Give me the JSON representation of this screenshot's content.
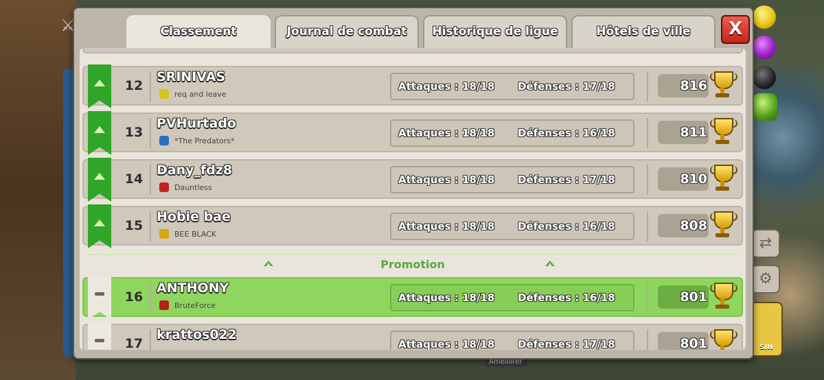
{
  "tabs": [
    {
      "label": "Classement",
      "active": true
    },
    {
      "label": "Journal de combat",
      "active": false
    },
    {
      "label": "Historique de ligue",
      "active": false
    },
    {
      "label": "Hôtels de ville",
      "active": false
    }
  ],
  "close_label": "X",
  "colors": {
    "promoted": "#2fa628",
    "me_row": "#8fd65f",
    "promo_text": "#5da73f"
  },
  "rows": [
    {
      "rank": "12",
      "name": "SRINIVAS",
      "clan": "req and leave",
      "attacks": "Attaques : 18/18",
      "defenses": "Défenses : 17/18",
      "trophies": "816",
      "status": "promoted",
      "badge_color": "#d9c321"
    },
    {
      "rank": "13",
      "name": "PVHurtado",
      "clan": "*The Predators*",
      "attacks": "Attaques : 18/18",
      "defenses": "Défenses : 16/18",
      "trophies": "811",
      "status": "promoted",
      "badge_color": "#2d6fc0"
    },
    {
      "rank": "14",
      "name": "Dany_fdz8",
      "clan": "Dauntless",
      "attacks": "Attaques : 18/18",
      "defenses": "Défenses : 17/18",
      "trophies": "810",
      "status": "promoted",
      "badge_color": "#c0261d"
    },
    {
      "rank": "15",
      "name": "Hobie bae",
      "clan": "BEE BLACK",
      "attacks": "Attaques : 18/18",
      "defenses": "Défenses : 16/18",
      "trophies": "808",
      "status": "promoted",
      "badge_color": "#d8a612"
    }
  ],
  "promotion_label": "Promotion",
  "me_row": {
    "rank": "16",
    "name": "ANTHONY",
    "clan": "BruteForce",
    "attacks": "Attaques : 18/18",
    "defenses": "Défenses : 16/18",
    "trophies": "801",
    "status": "stay",
    "badge_color": "#b32020"
  },
  "next_row": {
    "rank": "17",
    "name": "krattos022",
    "attacks": "Attaques : 18/18",
    "defenses": "Défenses : 17/18",
    "trophies": "801"
  },
  "background": {
    "shop_label": "SIN",
    "upgrade_label": "Améliorer"
  }
}
